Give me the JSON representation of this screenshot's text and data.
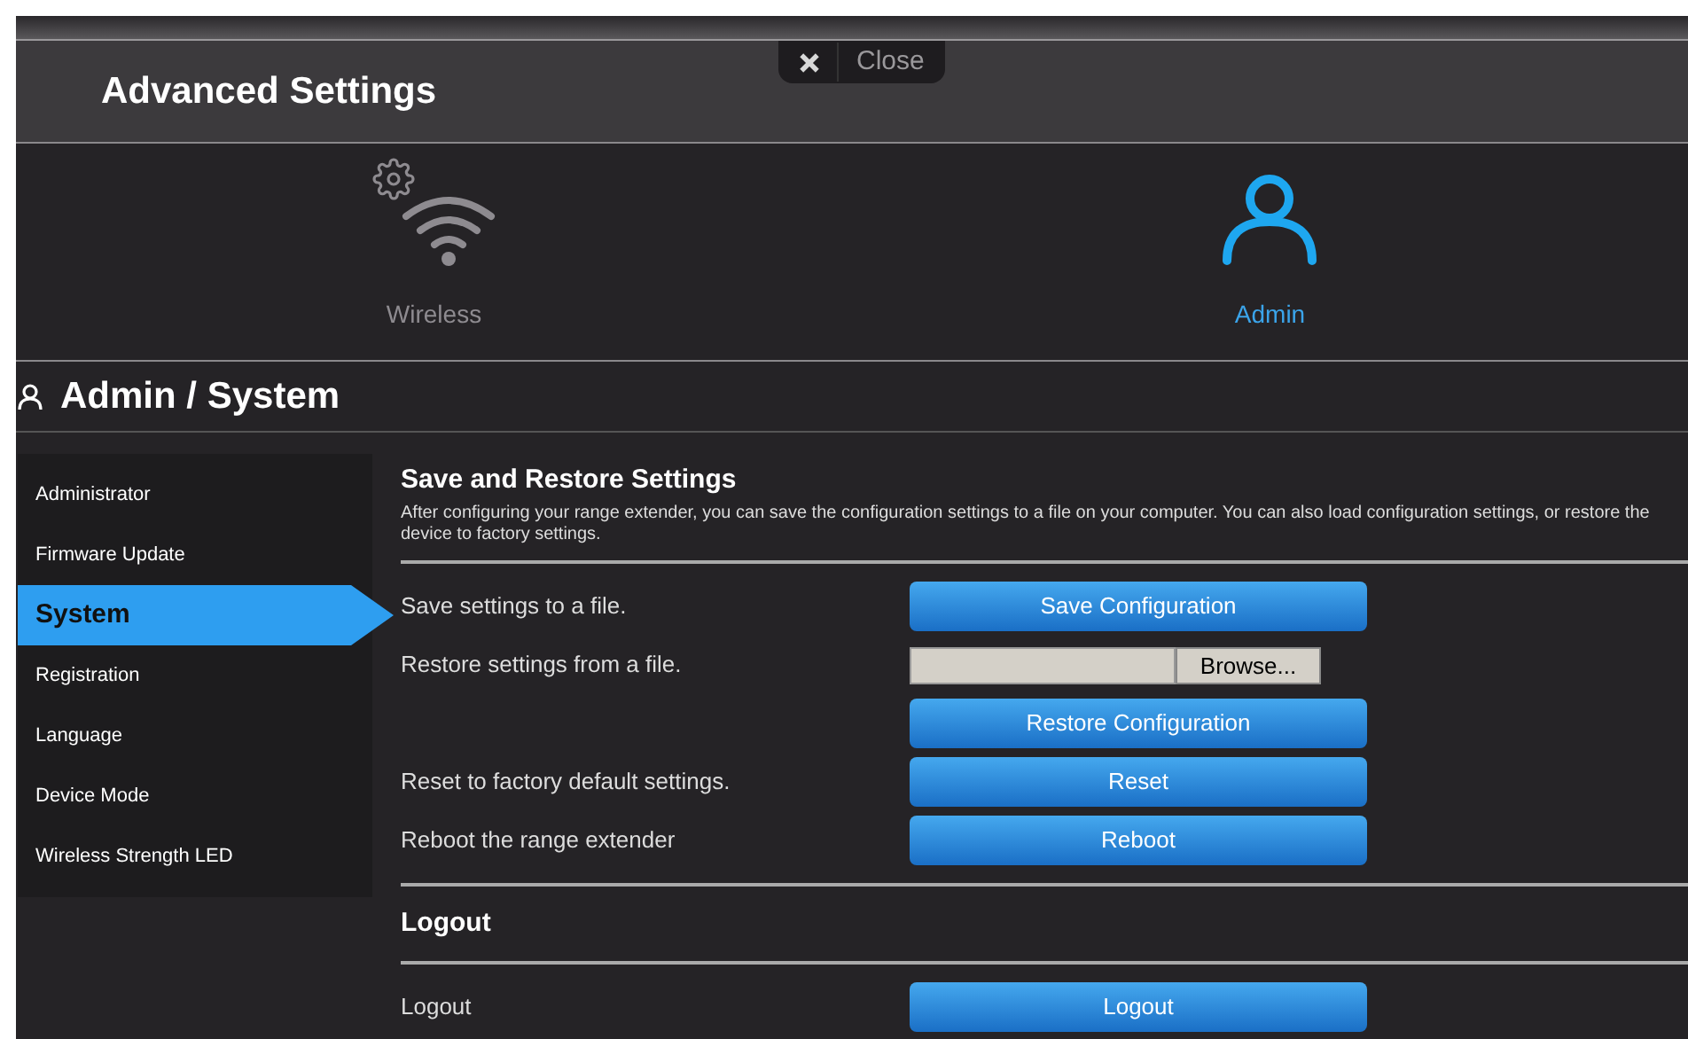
{
  "header": {
    "title": "Advanced Settings",
    "close_label": "Close"
  },
  "nav": [
    {
      "label": "Wireless",
      "kind": "wireless",
      "selected": false
    },
    {
      "label": "Admin",
      "kind": "admin",
      "selected": true
    }
  ],
  "page_title": "Admin / System",
  "sidebar": {
    "items": [
      {
        "label": "Administrator",
        "selected": false
      },
      {
        "label": "Firmware Update",
        "selected": false
      },
      {
        "label": "System",
        "selected": true
      },
      {
        "label": "Registration",
        "selected": false
      },
      {
        "label": "Language",
        "selected": false
      },
      {
        "label": "Device Mode",
        "selected": false
      },
      {
        "label": "Wireless Strength LED",
        "selected": false
      }
    ]
  },
  "sections": [
    {
      "title": "Save and Restore Settings",
      "description": "After configuring your range extender, you can save the configuration settings to a file on your computer. You can also load configuration settings, or restore the device to factory settings.",
      "rows": [
        {
          "kind": "button",
          "label": "Save settings to a file.",
          "button": "Save Configuration"
        },
        {
          "kind": "file",
          "label": "Restore settings from a file.",
          "button": "Browse..."
        },
        {
          "kind": "button",
          "button": "Restore Configuration"
        },
        {
          "kind": "button",
          "label": "Reset to factory default settings.",
          "button": "Reset"
        },
        {
          "kind": "button",
          "label": "Reboot the range extender",
          "button": "Reboot"
        }
      ]
    },
    {
      "title": "Logout",
      "rows": [
        {
          "kind": "button",
          "label": "Logout",
          "button": "Logout"
        }
      ]
    }
  ]
}
